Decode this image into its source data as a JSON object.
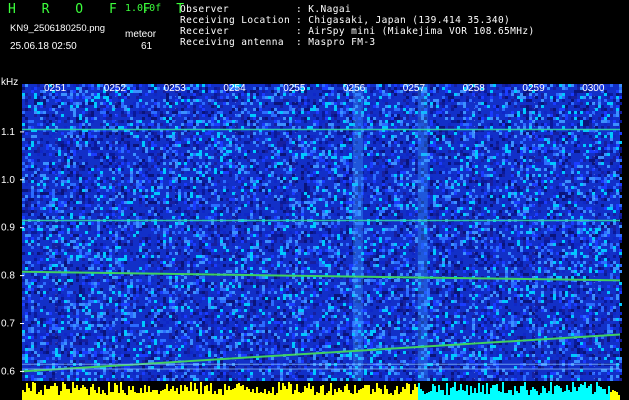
{
  "header": {
    "app_name": "H R O F F T",
    "version": "1.0.0f",
    "filename": "KN9_2506180250.png",
    "datetime": "25.06.18 02:50",
    "mode_label": "meteor",
    "count": "61"
  },
  "info": {
    "observer_label": "Observer",
    "observer_value": ": K.Nagai",
    "location_label": "Receiving Location",
    "location_value": ": Chigasaki, Japan (139.414 35.340)",
    "receiver_label": "Receiver",
    "receiver_value": ": AirSpy mini (Miakejima VOR 108.65MHz)",
    "antenna_label": "Receiving antenna",
    "antenna_value": ": Maspro FM-3"
  },
  "colors": {
    "background": "#000000",
    "header_text_green": "#3cff3c",
    "noise_blue": "#1230c8",
    "line_green": "#40d060",
    "baseline_yellow": "#ffff00",
    "baseline_cyan": "#00ffff"
  },
  "chart_data": {
    "type": "heatmap",
    "ylabel": "kHz",
    "ylim": [
      0.58,
      1.2
    ],
    "x_ticks": [
      "0251",
      "0252",
      "0253",
      "0254",
      "0255",
      "0256",
      "0257",
      "0258",
      "0259",
      "0300"
    ],
    "y_ticks": [
      "1.1",
      "1.0",
      "0.9",
      "0.8",
      "0.7",
      "0.6"
    ],
    "horizontal_lines_khz": [
      1.105,
      0.915
    ],
    "drift_lines": [
      {
        "start_khz": 0.808,
        "end_khz": 0.79
      },
      {
        "start_khz": 0.6,
        "end_khz": 0.677
      }
    ],
    "bright_columns_at": [
      "0256",
      "0257"
    ]
  }
}
